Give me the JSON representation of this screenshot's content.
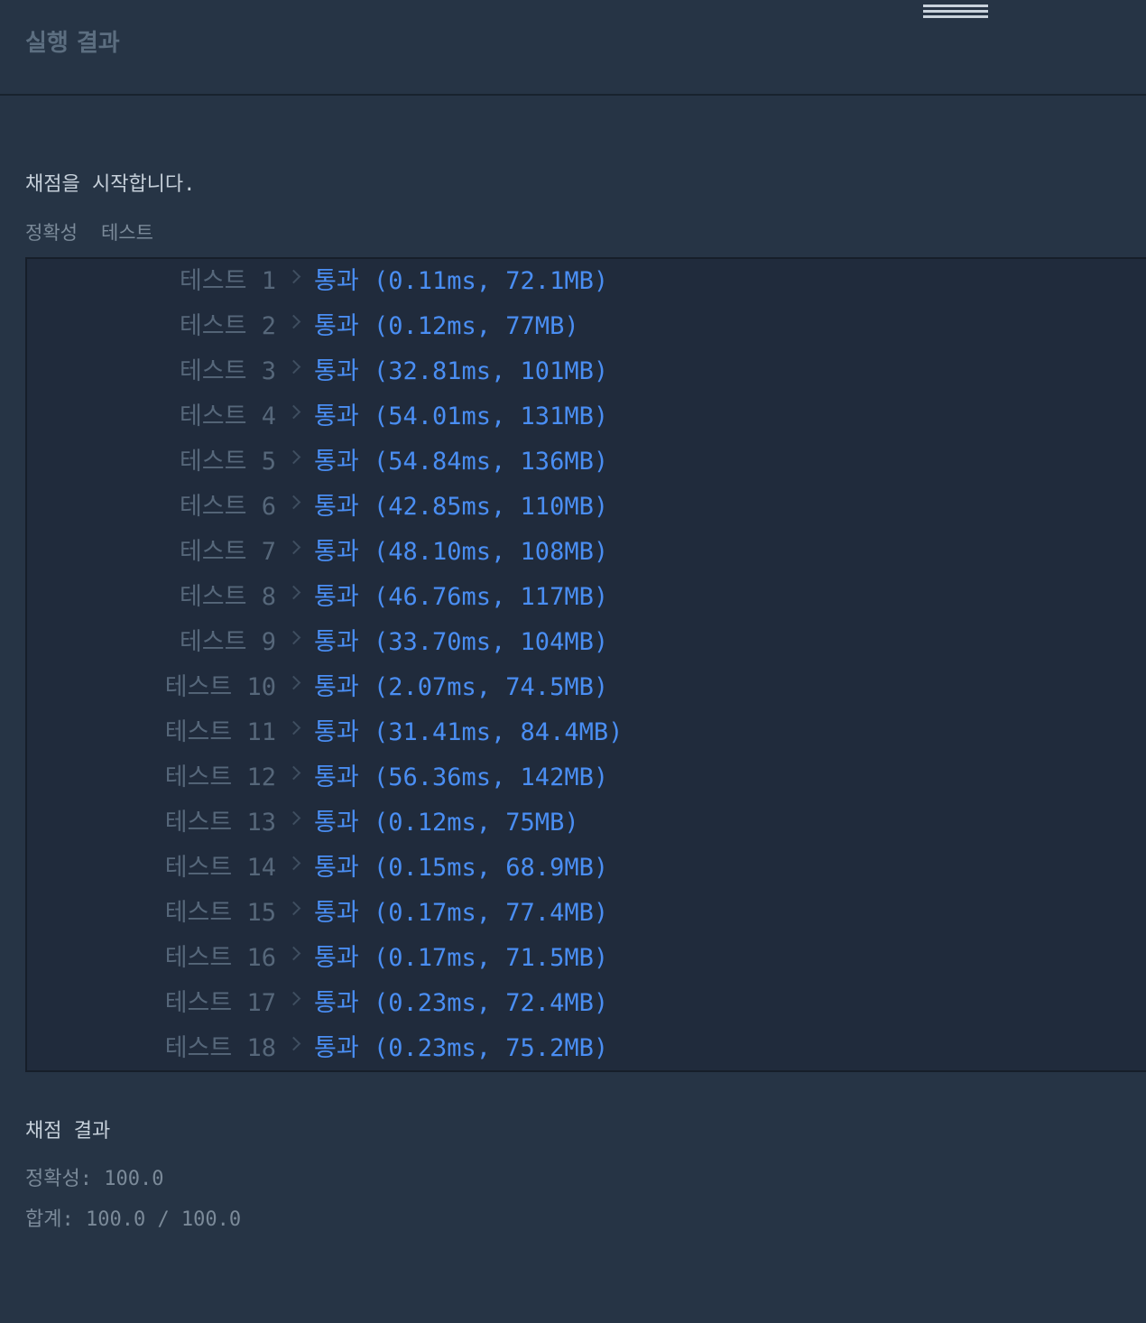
{
  "header": {
    "title": "실행 결과"
  },
  "grading": {
    "start_message": "채점을 시작합니다.",
    "tabs": [
      "정확성",
      "테스트"
    ]
  },
  "tests": [
    {
      "label": "테스트 1",
      "status": "통과",
      "detail": "(0.11ms, 72.1MB)"
    },
    {
      "label": "테스트 2",
      "status": "통과",
      "detail": "(0.12ms, 77MB)"
    },
    {
      "label": "테스트 3",
      "status": "통과",
      "detail": "(32.81ms, 101MB)"
    },
    {
      "label": "테스트 4",
      "status": "통과",
      "detail": "(54.01ms, 131MB)"
    },
    {
      "label": "테스트 5",
      "status": "통과",
      "detail": "(54.84ms, 136MB)"
    },
    {
      "label": "테스트 6",
      "status": "통과",
      "detail": "(42.85ms, 110MB)"
    },
    {
      "label": "테스트 7",
      "status": "통과",
      "detail": "(48.10ms, 108MB)"
    },
    {
      "label": "테스트 8",
      "status": "통과",
      "detail": "(46.76ms, 117MB)"
    },
    {
      "label": "테스트 9",
      "status": "통과",
      "detail": "(33.70ms, 104MB)"
    },
    {
      "label": "테스트 10",
      "status": "통과",
      "detail": "(2.07ms, 74.5MB)"
    },
    {
      "label": "테스트 11",
      "status": "통과",
      "detail": "(31.41ms, 84.4MB)"
    },
    {
      "label": "테스트 12",
      "status": "통과",
      "detail": "(56.36ms, 142MB)"
    },
    {
      "label": "테스트 13",
      "status": "통과",
      "detail": "(0.12ms, 75MB)"
    },
    {
      "label": "테스트 14",
      "status": "통과",
      "detail": "(0.15ms, 68.9MB)"
    },
    {
      "label": "테스트 15",
      "status": "통과",
      "detail": "(0.17ms, 77.4MB)"
    },
    {
      "label": "테스트 16",
      "status": "통과",
      "detail": "(0.17ms, 71.5MB)"
    },
    {
      "label": "테스트 17",
      "status": "통과",
      "detail": "(0.23ms, 72.4MB)"
    },
    {
      "label": "테스트 18",
      "status": "통과",
      "detail": "(0.23ms, 75.2MB)"
    }
  ],
  "summary": {
    "title": "채점 결과",
    "accuracy": "정확성: 100.0",
    "total": "합계: 100.0 / 100.0"
  },
  "colors": {
    "background": "#263445",
    "result_box": "#202b3c",
    "pass": "#4a8ef3",
    "muted": "#56677a"
  }
}
